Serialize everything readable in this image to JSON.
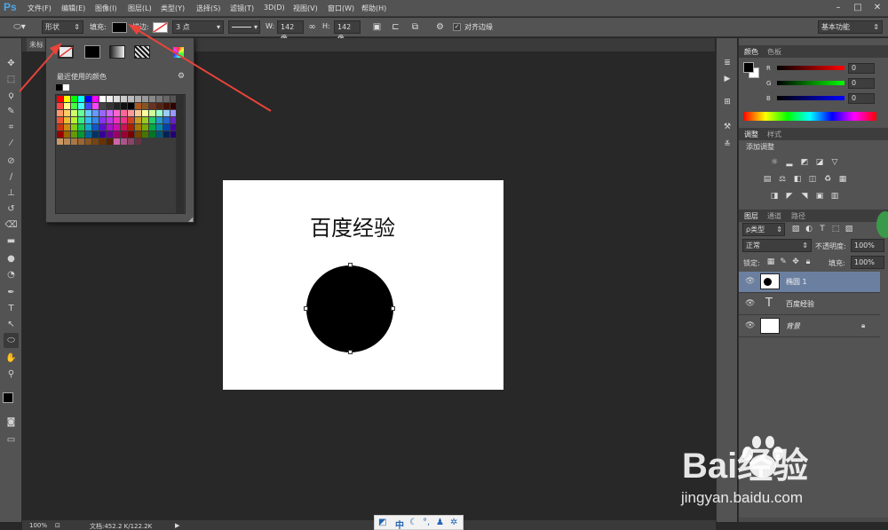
{
  "app": {
    "logo": "Ps"
  },
  "menu": [
    "文件(F)",
    "编辑(E)",
    "图像(I)",
    "图层(L)",
    "类型(Y)",
    "选择(S)",
    "滤镜(T)",
    "3D(D)",
    "视图(V)",
    "窗口(W)",
    "帮助(H)"
  ],
  "options": {
    "mode": "形状",
    "fill_label": "填充:",
    "stroke_label": "描边:",
    "stroke_size": "3 点",
    "w_label": "W:",
    "w_value": "142 像",
    "h_label": "H:",
    "h_value": "142 像",
    "align_edges": "对齐边缘",
    "workspace": "基本功能"
  },
  "doc_tab": "未标",
  "popup": {
    "recent_colors_label": "最近使用的颜色"
  },
  "canvas": {
    "text": "百度经验"
  },
  "color_panel": {
    "tabs": [
      "颜色",
      "色板"
    ],
    "channels": [
      {
        "name": "R",
        "value": "0"
      },
      {
        "name": "G",
        "value": "0"
      },
      {
        "name": "B",
        "value": "0"
      }
    ]
  },
  "adjust_panel": {
    "tabs": [
      "调整",
      "样式"
    ],
    "title": "添加调整"
  },
  "layers_panel": {
    "tabs": [
      "图层",
      "通道",
      "路径"
    ],
    "filter": "ρ类型",
    "blend_mode": "正常",
    "opacity_label": "不透明度:",
    "opacity_value": "100%",
    "lock_label": "锁定:",
    "fill_label": "填充:",
    "fill_value": "100%",
    "layers": [
      {
        "name": "椭圆 1",
        "type": "shape",
        "selected": true
      },
      {
        "name": "百度经验",
        "type": "text",
        "selected": false
      },
      {
        "name": "背景",
        "type": "background",
        "selected": false
      }
    ]
  },
  "status": {
    "zoom": "100%",
    "doc_info": "文档:452.2 K/122.2K"
  },
  "ime": {
    "mode": "中"
  },
  "watermark": {
    "logo": "Bai经验",
    "url": "jingyan.baidu.com"
  },
  "colors": {
    "canvas_bg": "#282828",
    "panel_bg": "#535353",
    "accent_arrow": "#e8443a",
    "ps_blue": "#4fa6e8"
  }
}
